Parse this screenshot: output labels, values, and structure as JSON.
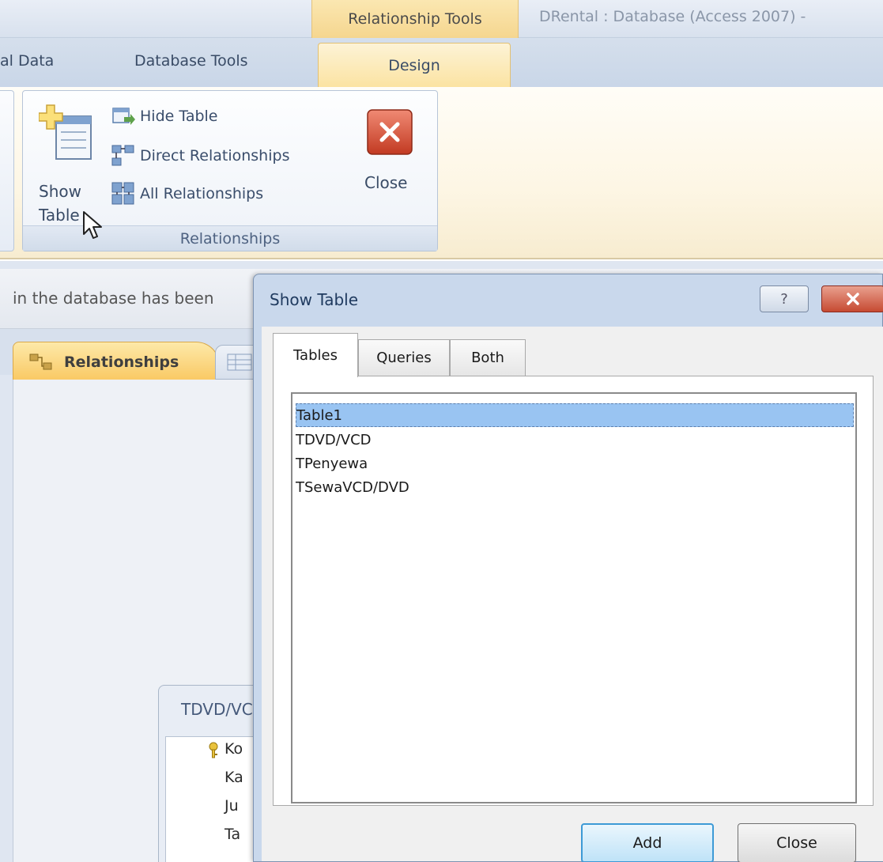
{
  "titlebar": {
    "context_tab": "Relationship Tools",
    "window_title": "DRental : Database (Access 2007) -"
  },
  "ribbon_tabs": {
    "external_data": "al Data",
    "database_tools": "Database Tools",
    "design": "Design"
  },
  "ribbon": {
    "show_table_label": "Show\nTable",
    "hide_table": "Hide Table",
    "direct_relationships": "Direct Relationships",
    "all_relationships": "All Relationships",
    "close_label": "Close",
    "group_label": "Relationships"
  },
  "message_bar": {
    "text": "in the database has been"
  },
  "document_tabs": {
    "relationships": "Relationships"
  },
  "table_window": {
    "title": "TDVD/VCD",
    "fields": [
      "Ko",
      "Ka",
      "Ju",
      "Ta"
    ]
  },
  "dialog": {
    "title": "Show Table",
    "help_symbol": "?",
    "tabs": [
      "Tables",
      "Queries",
      "Both"
    ],
    "tables": [
      "Table1",
      "TDVD/VCD",
      "TPenyewa",
      "TSewaVCD/DVD"
    ],
    "selected_table": "Table1",
    "add_label": "Add",
    "close_label": "Close"
  },
  "colors": {
    "context_accent": "#f5d68f",
    "selection": "#99c4f2",
    "close_red": "#c64a32"
  }
}
